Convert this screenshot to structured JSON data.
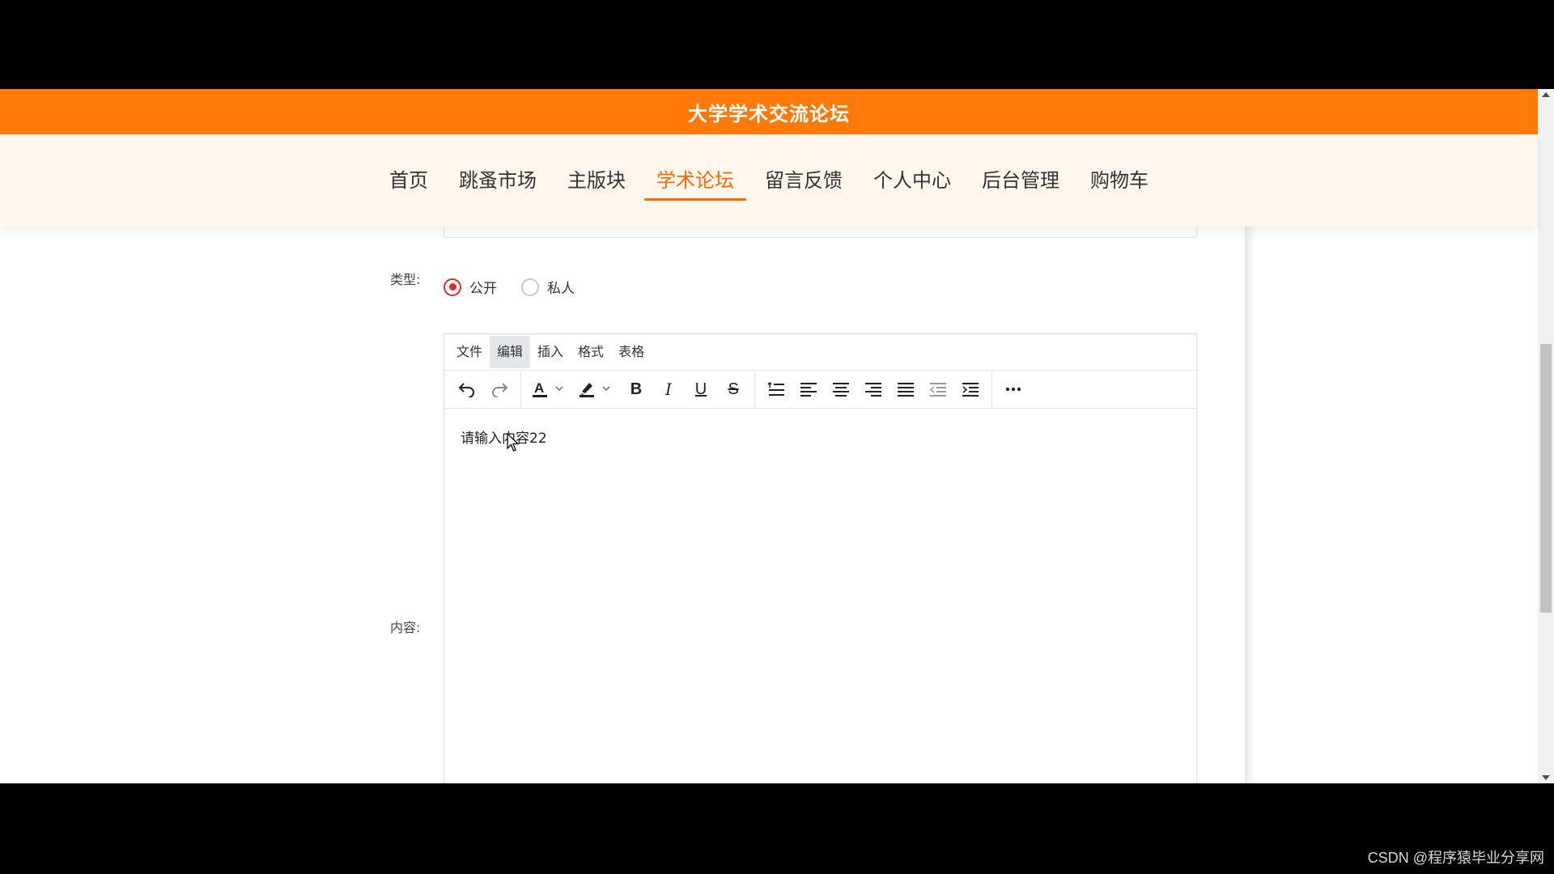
{
  "header": {
    "title": "大学学术交流论坛"
  },
  "nav": {
    "items": [
      {
        "label": "首页"
      },
      {
        "label": "跳蚤市场"
      },
      {
        "label": "主版块"
      },
      {
        "label": "学术论坛"
      },
      {
        "label": "留言反馈"
      },
      {
        "label": "个人中心"
      },
      {
        "label": "后台管理"
      },
      {
        "label": "购物车"
      }
    ],
    "active": "学术论坛"
  },
  "form": {
    "type_label": "类型:",
    "type_options": [
      {
        "label": "公开",
        "checked": true
      },
      {
        "label": "私人",
        "checked": false
      }
    ],
    "content_label": "内容:"
  },
  "editor": {
    "menus": [
      {
        "label": "文件"
      },
      {
        "label": "编辑"
      },
      {
        "label": "插入"
      },
      {
        "label": "格式"
      },
      {
        "label": "表格"
      }
    ],
    "hovered_menu": "编辑",
    "toolbar": {
      "bold": "B",
      "italic": "I",
      "underline": "U",
      "strike": "S",
      "font_color_letter": "A"
    },
    "body_text": "请输入内容22"
  },
  "watermark": "CSDN @程序猿毕业分享网",
  "colors": {
    "brand": "#ff7a0a",
    "active_nav": "#ff6a00",
    "radio": "#e02a2a"
  }
}
